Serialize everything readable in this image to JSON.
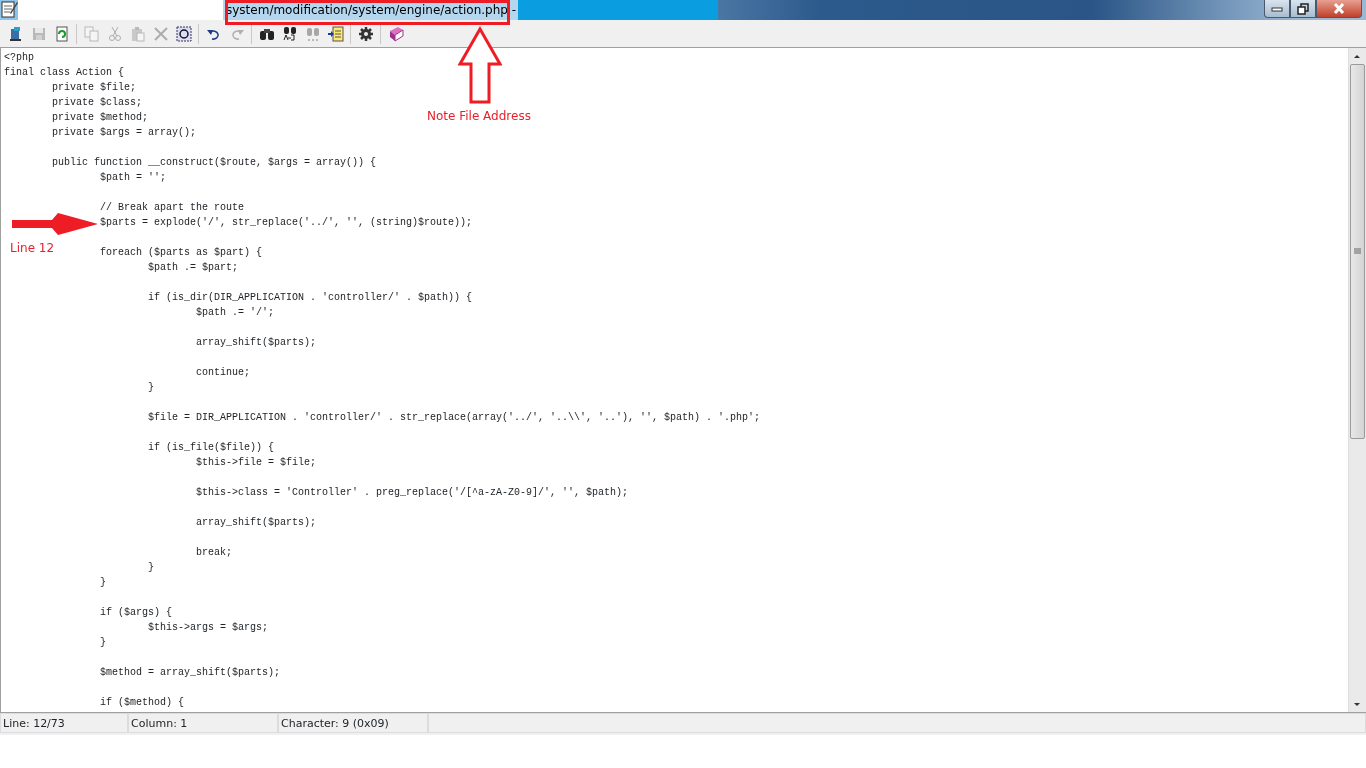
{
  "window": {
    "title": "system/modification/system/engine/action.php -",
    "title_selected": true
  },
  "toolbar": [
    {
      "kind": "open",
      "disabled": false
    },
    {
      "kind": "save",
      "disabled": true
    },
    {
      "kind": "reload",
      "disabled": false
    },
    {
      "kind": "sep"
    },
    {
      "kind": "copy",
      "disabled": true
    },
    {
      "kind": "cut",
      "disabled": true
    },
    {
      "kind": "paste",
      "disabled": true
    },
    {
      "kind": "delete",
      "disabled": true
    },
    {
      "kind": "selectall",
      "disabled": false
    },
    {
      "kind": "sep"
    },
    {
      "kind": "undo",
      "disabled": false
    },
    {
      "kind": "redo",
      "disabled": true
    },
    {
      "kind": "sep"
    },
    {
      "kind": "find",
      "disabled": false
    },
    {
      "kind": "replace",
      "disabled": false
    },
    {
      "kind": "findnext",
      "disabled": true
    },
    {
      "kind": "insert",
      "disabled": false
    },
    {
      "kind": "sep"
    },
    {
      "kind": "settings",
      "disabled": false
    },
    {
      "kind": "sep"
    },
    {
      "kind": "help",
      "disabled": false
    }
  ],
  "code_blocks": [
    [
      "<?php",
      "final class Action {",
      "\tprivate $file;",
      "\tprivate $class;",
      "\tprivate $method;",
      "\tprivate $args = array();"
    ],
    [
      "\tpublic function __construct($route, $args = array()) {",
      "\t\t$path = '';"
    ],
    [
      "\t\t// Break apart the route",
      "\t\t$parts = explode('/', str_replace('../', '', (string)$route));"
    ],
    [
      "\t\tforeach ($parts as $part) {",
      "\t\t\t$path .= $part;"
    ],
    [
      "\t\t\tif (is_dir(DIR_APPLICATION . 'controller/' . $path)) {",
      "\t\t\t\t$path .= '/';"
    ],
    [
      "\t\t\t\tarray_shift($parts);"
    ],
    [
      "\t\t\t\tcontinue;",
      "\t\t\t}"
    ],
    [
      "\t\t\t$file = DIR_APPLICATION . 'controller/' . str_replace(array('../', '..\\\\', '..'), '', $path) . '.php';"
    ],
    [
      "\t\t\tif (is_file($file)) {",
      "\t\t\t\t$this->file = $file;"
    ],
    [
      "\t\t\t\t$this->class = 'Controller' . preg_replace('/[^a-zA-Z0-9]/', '', $path);"
    ],
    [
      "\t\t\t\tarray_shift($parts);"
    ],
    [
      "\t\t\t\tbreak;",
      "\t\t\t}",
      "\t\t}"
    ],
    [
      "\t\tif ($args) {",
      "\t\t\t$this->args = $args;",
      "\t\t}"
    ],
    [
      "\t\t$method = array_shift($parts);"
    ],
    [
      "\t\tif ($method) {"
    ]
  ],
  "status_bar": [
    "Line: 12/73",
    "Column: 1",
    "Character: 9 (0x09)"
  ],
  "annotations": [
    {
      "kind": "title_box"
    },
    {
      "kind": "up_arrow",
      "label": "Note File Address"
    },
    {
      "kind": "right_arrow",
      "label": "Line 12"
    }
  ]
}
